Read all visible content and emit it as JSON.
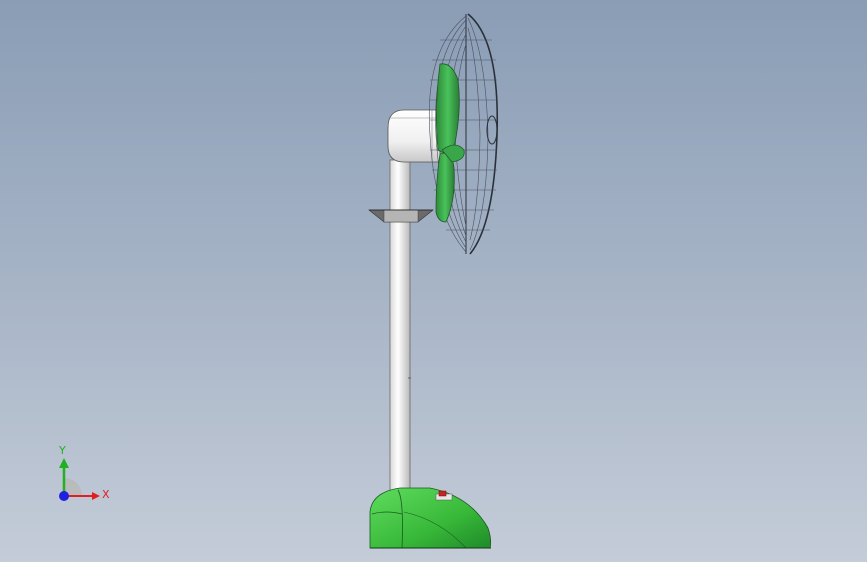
{
  "view": {
    "background_top": "#8a9db5",
    "background_bottom": "#c4ccd8"
  },
  "model": {
    "base_color": "#3fbf3f",
    "blade_color": "#3aa64a",
    "switch_color": "#cc2222",
    "pole_color": "#f2f2f2",
    "cage_color": "#4a5060"
  },
  "triad": {
    "x_label": "X",
    "y_label": "Y",
    "x_color": "#e02020",
    "y_color": "#20b020",
    "z_color": "#2020e0"
  }
}
